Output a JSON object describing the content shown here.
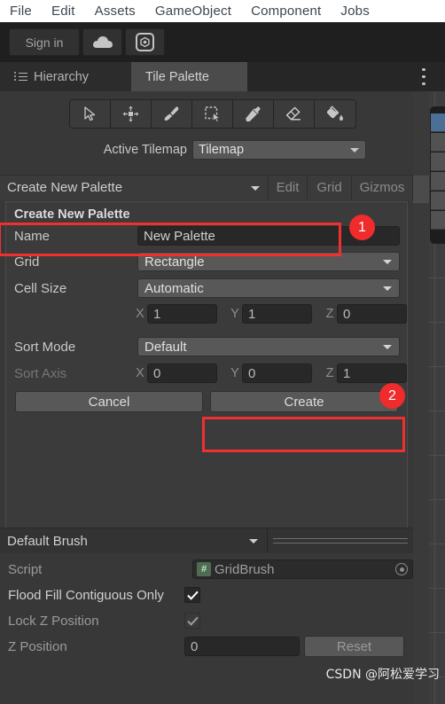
{
  "menubar": {
    "items": [
      "File",
      "Edit",
      "Assets",
      "GameObject",
      "Component",
      "Jobs"
    ]
  },
  "unity_toolbar": {
    "sign_in_label": "Sign in",
    "cloud_icon": "cloud-icon",
    "services_icon": "unity-services-icon"
  },
  "tabs": [
    {
      "label": "Hierarchy",
      "icon": "hierarchy-icon",
      "active": false
    },
    {
      "label": "Tile Palette",
      "icon": "",
      "active": true
    }
  ],
  "panel_menu_icon": "kebab-menu-icon",
  "tilemap_tools": [
    {
      "name": "select-tool",
      "icon": "cursor-arrow-icon"
    },
    {
      "name": "move-tool",
      "icon": "move-arrows-icon"
    },
    {
      "name": "paint-brush-tool",
      "icon": "paintbrush-icon"
    },
    {
      "name": "box-fill-tool",
      "icon": "box-select-icon"
    },
    {
      "name": "picker-tool",
      "icon": "eyedropper-icon"
    },
    {
      "name": "eraser-tool",
      "icon": "eraser-icon"
    },
    {
      "name": "fill-tool",
      "icon": "paint-bucket-icon"
    }
  ],
  "active_tilemap": {
    "label": "Active Tilemap",
    "value": "Tilemap"
  },
  "palette_toolbar": {
    "palette_dropdown": "Create New Palette",
    "edit_label": "Edit",
    "grid_label": "Grid",
    "gizmos_label": "Gizmos"
  },
  "dialog": {
    "title": "Create New Palette",
    "name": {
      "label": "Name",
      "value": "New Palette"
    },
    "grid": {
      "label": "Grid",
      "value": "Rectangle"
    },
    "cell_size": {
      "label": "Cell Size",
      "value": "Automatic"
    },
    "cell_size_axes": {
      "x_label": "X",
      "x_value": "1",
      "y_label": "Y",
      "y_value": "1",
      "z_label": "Z",
      "z_value": "0"
    },
    "sort_mode": {
      "label": "Sort Mode",
      "value": "Default"
    },
    "sort_axis": {
      "label": "Sort Axis",
      "x_label": "X",
      "x_value": "0",
      "y_label": "Y",
      "y_value": "0",
      "z_label": "Z",
      "z_value": "1"
    },
    "cancel_label": "Cancel",
    "create_label": "Create"
  },
  "annotations": [
    {
      "number": "1",
      "target": "name-field"
    },
    {
      "number": "2",
      "target": "create-button"
    }
  ],
  "brush": {
    "dropdown": "Default Brush",
    "script": {
      "label": "Script",
      "value": "GridBrush",
      "icon": "script-icon"
    },
    "flood_fill": {
      "label": "Flood Fill Contiguous Only",
      "checked": true
    },
    "lock_z": {
      "label": "Lock Z Position",
      "checked": true
    },
    "z_position": {
      "label": "Z Position",
      "value": "0",
      "reset_label": "Reset"
    }
  },
  "watermark": "CSDN @阿松爱学习",
  "colors": {
    "accent_red": "#f02b2b",
    "panel_bg": "#383838",
    "menubar_bg": "#ffffff",
    "toolbar_bg": "#1f1f1f",
    "selected_tab": "#4b4b4b"
  }
}
